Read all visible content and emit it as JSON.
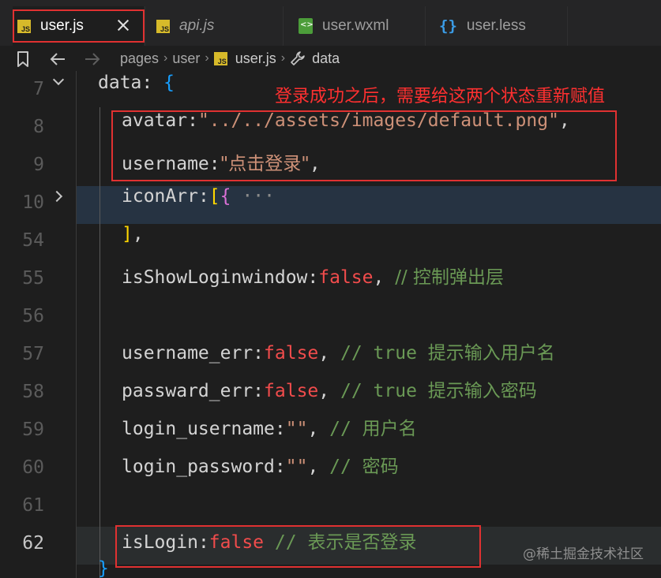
{
  "tabs": [
    {
      "name": "user.js",
      "icon": "js-file-icon",
      "active": true
    },
    {
      "name": "api.js",
      "icon": "js-file-icon",
      "active": false
    },
    {
      "name": "user.wxml",
      "icon": "wxml-file-icon",
      "active": false
    },
    {
      "name": "user.less",
      "icon": "braces-icon",
      "active": false
    }
  ],
  "breadcrumb": {
    "items": [
      "pages",
      "user",
      "user.js",
      "data"
    ],
    "icons": [
      "bookmark-icon",
      "arrow-left-icon",
      "arrow-right-icon",
      "js-file-icon",
      "wrench-icon"
    ]
  },
  "editor": {
    "line_numbers": [
      "7",
      "8",
      "9",
      "10",
      "54",
      "55",
      "56",
      "57",
      "58",
      "59",
      "60",
      "61",
      "62"
    ],
    "current_line": "62",
    "code": {
      "l7_key": "data",
      "l7_colon": ": ",
      "l7_brace": "{",
      "l8_key": "avatar",
      "l8_val": "\"../../assets/images/default.png\"",
      "l9_key": "username",
      "l9_val": "\"点击登录\"",
      "l10_key": "iconArr",
      "l10_bracket": "[",
      "l10_brace": "{",
      "l10_ellipsis": "···",
      "l54_close": "]",
      "l55_key": "isShowLoginwindow",
      "l55_val": "false",
      "l55_cmt": "// 控制弹出层",
      "l57_key": "username_err",
      "l57_val": "false",
      "l57_cmt": "// true 提示输入用户名",
      "l58_key": "passward_err",
      "l58_val": "false",
      "l58_cmt": "// true 提示输入密码",
      "l59_key": "login_username",
      "l59_val": "\"\"",
      "l59_cmt": "// 用户名",
      "l60_key": "login_password",
      "l60_val": "\"\"",
      "l60_cmt": "// 密码",
      "l62_key": "isLogin",
      "l62_val": "false",
      "l62_cmt": "// 表示是否登录"
    }
  },
  "annotation": "登录成功之后，需要给这两个状态重新赋值",
  "watermark": "@稀土掘金技术社区",
  "colors": {
    "annotation_red": "#ff3030",
    "string": "#ce9178",
    "keyword": "#f14c4c",
    "comment": "#6a9955",
    "js_badge": "#d7ba2a"
  }
}
